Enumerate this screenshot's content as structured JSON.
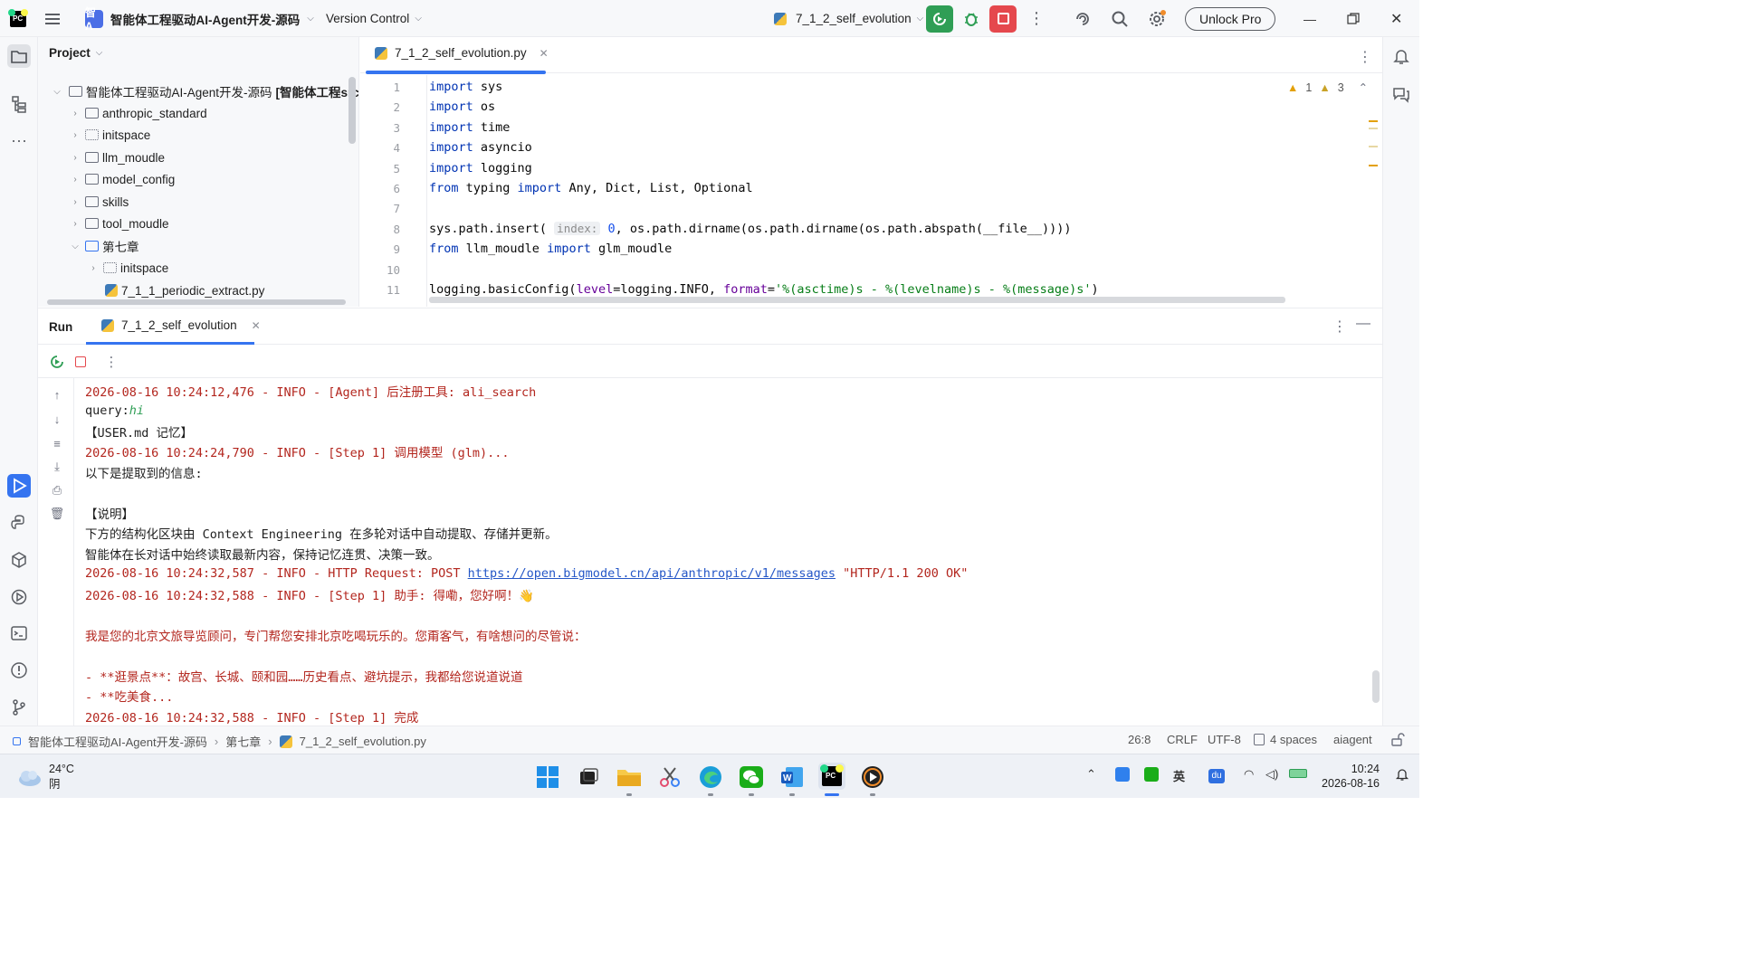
{
  "titlebar": {
    "project_badge": "智A",
    "project_name": "智能体工程驱动AI-Agent开发-源码",
    "vcs": "Version Control",
    "run_config": "7_1_2_self_evolution",
    "unlock": "Unlock Pro"
  },
  "project": {
    "title": "Project",
    "root": "智能体工程驱动AI-Agent开发-源码",
    "root_tag": "[智能体工程src]",
    "root_suffix": "sc",
    "items": [
      {
        "label": "anthropic_standard",
        "kind": "folder"
      },
      {
        "label": "initspace",
        "kind": "module"
      },
      {
        "label": "llm_moudle",
        "kind": "folder"
      },
      {
        "label": "model_config",
        "kind": "folder"
      },
      {
        "label": "skills",
        "kind": "folder"
      },
      {
        "label": "tool_moudle",
        "kind": "folder"
      },
      {
        "label": "第七章",
        "kind": "folder-open"
      },
      {
        "label": "initspace",
        "kind": "module"
      },
      {
        "label": "7_1_1_periodic_extract.py",
        "kind": "python"
      }
    ]
  },
  "editor": {
    "tab": "7_1_2_self_evolution.py",
    "warnings": "1",
    "weak_warnings": "3",
    "lines": {
      "l1": "1",
      "l2": "2",
      "l3": "3",
      "l4": "4",
      "l5": "5",
      "l6": "6",
      "l7": "7",
      "l8": "8",
      "l9": "9",
      "l10": "10",
      "l11": "11"
    },
    "code": {
      "import": "import",
      "from": "from",
      "sys": " sys",
      "os": " os",
      "time": " time",
      "asyncio": " asyncio",
      "logging": " logging",
      "typing": " typing ",
      "typing_names": " Any, Dict, List, Optional",
      "l8_a": "sys.path.insert( ",
      "l8_hint": "index:",
      "l8_num": " 0",
      "l8_b": ", os.path.dirname(os.path.dirname(os.path.abspath(__file__))))",
      "l9_mod": " llm_moudle ",
      "l9_name": " glm_moudle",
      "l11_a": "logging.basicConfig(",
      "l11_p1": "level",
      "l11_b": "=logging.INFO, ",
      "l11_p2": "format",
      "l11_c": "=",
      "l11_str": "'%(asctime)s - %(levelname)s - %(message)s'",
      "l11_d": ")"
    }
  },
  "run": {
    "label": "Run",
    "tab": "7_1_2_self_evolution",
    "log": {
      "r1": "2026-08-16 10:24:12,476 - INFO - [Agent] 后注册工具: ali_search",
      "r2a": "query:",
      "r2b": "hi",
      "r3": "【USER.md 记忆】",
      "r4": "2026-08-16 10:24:24,790 - INFO - [Step 1] 调用模型 (glm)...",
      "r5": "以下是提取到的信息:",
      "r7": "【说明】",
      "r8": "下方的结构化区块由 Context Engineering 在多轮对话中自动提取、存储并更新。",
      "r9": "智能体在长对话中始终读取最新内容，保持记忆连贯、决策一致。",
      "r10a": "2026-08-16 10:24:32,587 - INFO - HTTP Request: POST ",
      "r10b": "https://open.bigmodel.cn/api/anthropic/v1/messages",
      "r10c": " \"HTTP/1.1 200 OK\"",
      "r11": "2026-08-16 10:24:32,588 - INFO - [Step 1] 助手: 得嘞，您好啊！👋",
      "r13": "我是您的北京文旅导览顾问，专门帮您安排北京吃喝玩乐的。您甭客气，有啥想问的尽管说：",
      "r15": "- **逛景点**：故宫、长城、颐和园……历史看点、避坑提示，我都给您说道说道",
      "r16": "- **吃美食...",
      "r17": "2026-08-16 10:24:32,588 - INFO - [Step 1] 完成"
    }
  },
  "statusbar": {
    "crumb1": "智能体工程驱动AI-Agent开发-源码",
    "crumb2": "第七章",
    "crumb3": "7_1_2_self_evolution.py",
    "position": "26:8",
    "eol": "CRLF",
    "encoding": "UTF-8",
    "indent": "4 spaces",
    "interpreter": "aiagent"
  },
  "taskbar": {
    "temp": "24°C",
    "weather": "阴",
    "time": "10:24",
    "date": "2026-08-16"
  }
}
